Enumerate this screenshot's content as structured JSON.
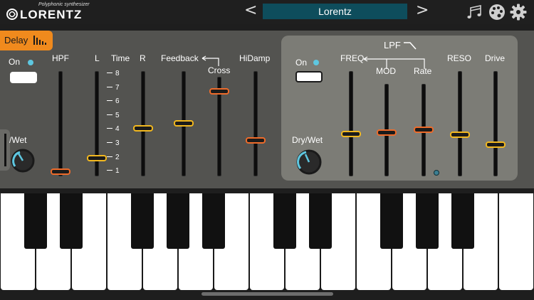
{
  "header": {
    "logo_tagline": "Polyphonic synthesizer",
    "logo_name": "LORENTZ",
    "prev_label": "<",
    "next_label": ">",
    "preset_name": "Lorentz",
    "icons": [
      "music-notes-icon",
      "palette-icon",
      "gear-icon"
    ]
  },
  "delay": {
    "tab_label": "Delay",
    "on_label": "On",
    "drywet_label": "/Wet",
    "labels": {
      "hpf": "HPF",
      "l": "L",
      "time": "Time",
      "r": "R",
      "feedback": "Feedback",
      "cross": "Cross",
      "hidamp": "HiDamp"
    },
    "time_scale": [
      "8",
      "7",
      "6",
      "5",
      "4",
      "3",
      "2",
      "1"
    ],
    "sliders": {
      "hpf": 0.04,
      "l": 0.17,
      "r": 0.45,
      "feedback": 0.5,
      "cross": 0.85,
      "hidamp": 0.34
    }
  },
  "lpf": {
    "title": "LPF",
    "on_label": "On",
    "drywet_label": "Dry/Wet",
    "labels": {
      "freq": "FREQ",
      "mod": "MOD",
      "rate": "Rate",
      "reso": "RESO",
      "drive": "Drive"
    },
    "sliders": {
      "freq": 0.4,
      "mod": 0.47,
      "rate": 0.5,
      "reso": 0.39,
      "drive": 0.3
    }
  },
  "keyboard": {
    "white_keys": 15
  },
  "colors": {
    "accent_orange": "#f08a1d",
    "preset_bg": "#0e4d5c",
    "led_blue": "#5ec7e0"
  }
}
